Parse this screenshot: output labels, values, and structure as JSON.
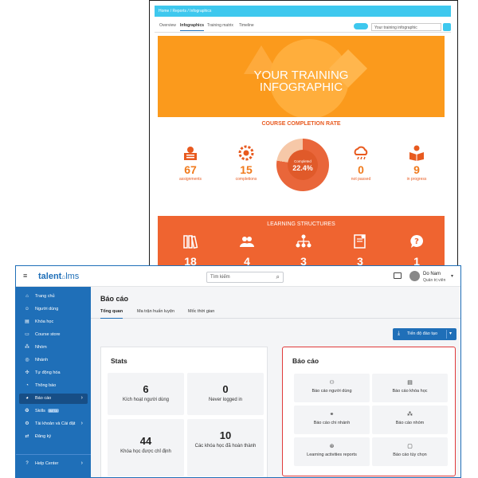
{
  "colors": {
    "infographic_orange": "#fb9a1c",
    "structures_orange": "#ef6430",
    "stat_orange": "#f07a1c",
    "lms_blue": "#1f6fb8",
    "highlight_red": "#e03a3a",
    "breadcrumb_cyan": "#3ec8ee"
  },
  "back": {
    "breadcrumb": "Home  /  Reports  /  Infographics",
    "tabs": [
      "Overview",
      "Infographics",
      "Training matrix",
      "Timeline"
    ],
    "active_tab": "Infographics",
    "select_value": "Your training infographic",
    "hero_title_line1": "YOUR TRAINING",
    "hero_title_line2": "INFOGRAPHIC",
    "completion_heading": "COURSE COMPLETION RATE",
    "stats": [
      {
        "icon": "assignments-icon",
        "value": "67",
        "label": "assignments"
      },
      {
        "icon": "gear-icon",
        "value": "15",
        "label": "completions"
      },
      {
        "icon": "cloud-icon",
        "value": "0",
        "label": "not passed"
      },
      {
        "icon": "reader-icon",
        "value": "9",
        "label": "in progress"
      }
    ],
    "completion": {
      "label": "Completed",
      "value": "22.4%",
      "fraction": 0.224
    },
    "structures_heading": "LEARNING STRUCTURES",
    "structures": [
      {
        "icon": "books-icon",
        "value": "18"
      },
      {
        "icon": "users-icon",
        "value": "4"
      },
      {
        "icon": "hierarchy-icon",
        "value": "3"
      },
      {
        "icon": "certificate-icon",
        "value": "3"
      },
      {
        "icon": "question-icon",
        "value": "1"
      }
    ]
  },
  "front": {
    "logo_part1": "talent",
    "logo_part2": "lms",
    "search_placeholder": "Tìm kiếm",
    "user_name": "Do Nam",
    "user_role": "Quản trị viên",
    "sidebar": [
      {
        "icon": "home-icon",
        "label": "Trang chủ"
      },
      {
        "icon": "user-icon",
        "label": "Người dùng"
      },
      {
        "icon": "book-icon",
        "label": "Khóa học"
      },
      {
        "icon": "store-icon",
        "label": "Course store"
      },
      {
        "icon": "groups-icon",
        "label": "Nhóm"
      },
      {
        "icon": "branches-icon",
        "label": "Nhánh"
      },
      {
        "icon": "automation-icon",
        "label": "Tự động hóa"
      },
      {
        "icon": "bell-icon",
        "label": "Thông báo"
      },
      {
        "icon": "reports-icon",
        "label": "Báo cáo"
      },
      {
        "icon": "skills-icon",
        "label": "Skills",
        "badge": "BETA"
      },
      {
        "icon": "settings-icon",
        "label": "Tài khoản và Cài đặt"
      },
      {
        "icon": "subscription-icon",
        "label": "Đăng ký"
      },
      {
        "icon": "help-icon",
        "label": "Help Center"
      }
    ],
    "page_title": "Báo cáo",
    "tabs": [
      "Tổng quan",
      "Ma trận huấn luyện",
      "Mốc thời gian"
    ],
    "progress_button": "Tiến độ đào tạo",
    "stats_title": "Stats",
    "stats": [
      {
        "value": "6",
        "label": "Kích hoạt người dùng"
      },
      {
        "value": "0",
        "label": "Never logged in"
      },
      {
        "value": "44",
        "label": "Khóa học được chỉ định"
      },
      {
        "value": "10",
        "label": "Các khóa học đã hoàn thành"
      }
    ],
    "reports_title": "Báo cáo",
    "reports": [
      {
        "icon": "user-report-icon",
        "label": "Báo cáo người dùng"
      },
      {
        "icon": "course-report-icon",
        "label": "Báo cáo khóa học"
      },
      {
        "icon": "branch-report-icon",
        "label": "Báo cáo chi nhánh"
      },
      {
        "icon": "group-report-icon",
        "label": "Báo cáo nhóm"
      },
      {
        "icon": "learning-report-icon",
        "label": "Learning activities reports"
      },
      {
        "icon": "custom-report-icon",
        "label": "Báo cáo tùy chọn"
      }
    ]
  }
}
